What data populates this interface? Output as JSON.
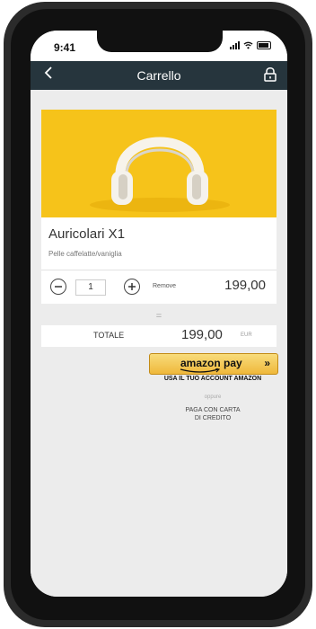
{
  "status": {
    "time": "9:41"
  },
  "navigation": {
    "title": "Carrello"
  },
  "product": {
    "name": "Auricolari X1",
    "description": "Pelle caffelatte/vaniglia",
    "quantity": "1",
    "remove_label": "Remove",
    "price": "199,00",
    "image_background": "#f6c31a"
  },
  "summary": {
    "equals_symbol": "=",
    "total_label": "TOTALE",
    "total_price": "199,00",
    "currency": "EUR"
  },
  "payment": {
    "amazon_button_label": "amazon pay",
    "amazon_button_arrow": "»",
    "amazon_account_text": "USA IL TUO ACCOUNT AMAZON",
    "separator": "oppure",
    "card_payment_line1": "PAGA CON CARTA",
    "card_payment_line2": "DI CREDITO"
  },
  "colors": {
    "navbar": "#26353d",
    "page_background": "#ececec",
    "amazon_button": "#efb83b"
  },
  "icons": {
    "back": "chevron-left-icon",
    "lock": "lock-icon",
    "minus": "minus-circle-icon",
    "plus": "plus-circle-icon",
    "headphones": "headphones-image"
  }
}
